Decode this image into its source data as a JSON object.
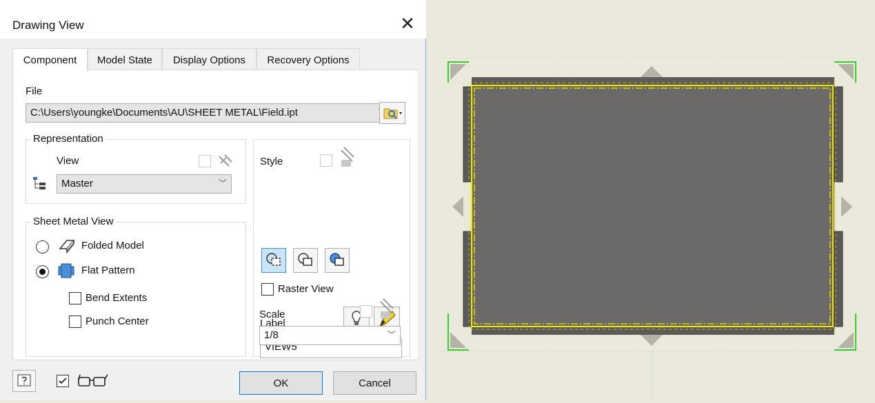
{
  "dialog": {
    "title": "Drawing View",
    "tabs": [
      "Component",
      "Model State",
      "Display Options",
      "Recovery Options"
    ],
    "file_label": "File",
    "file_path": "C:\\Users\\youngke\\Documents\\AU\\SHEET METAL\\Field.ipt",
    "representation": {
      "legend": "Representation",
      "view_label": "View",
      "view_value": "Master"
    },
    "sheet_metal": {
      "legend": "Sheet Metal View",
      "folded": "Folded Model",
      "flat": "Flat Pattern",
      "bend_extents": "Bend Extents",
      "punch_center": "Punch Center"
    },
    "style_label": "Style",
    "raster_view": "Raster View",
    "label_label": "Label",
    "label_value": "VIEW5",
    "scale_label": "Scale",
    "scale_value": "1/8",
    "ok": "OK",
    "cancel": "Cancel"
  },
  "colors": {
    "accent": "#0078d7",
    "part_fill": "#6b6a68",
    "selection_yellow": "#f0e600",
    "handle_green": "#33cc33",
    "canvas": "#ebe9dc"
  },
  "icons": [
    "question-help-icon",
    "glasses-icon",
    "browse-folder-icon",
    "tree-icon",
    "pencil-icon",
    "bulb-icon"
  ]
}
